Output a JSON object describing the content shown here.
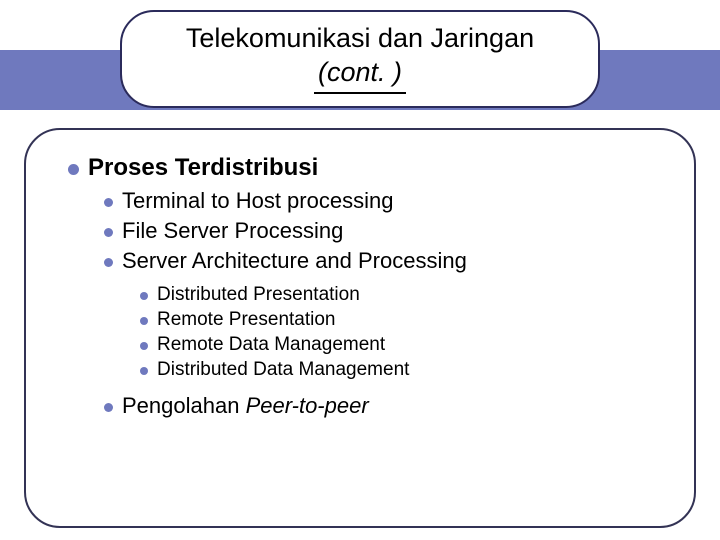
{
  "title_line1": "Telekomunikasi dan Jaringan",
  "title_line2": "(cont. )",
  "heading": "Proses Terdistribusi",
  "sub": {
    "a": "Terminal to Host processing",
    "b": "File Server Processing",
    "c": "Server Architecture and Processing"
  },
  "subsub": {
    "a": "Distributed Presentation",
    "b": "Remote Presentation",
    "c": "Remote Data Management",
    "d": "Distributed Data Management"
  },
  "last_prefix": "Pengolahan ",
  "last_italic": "Peer-to-peer"
}
